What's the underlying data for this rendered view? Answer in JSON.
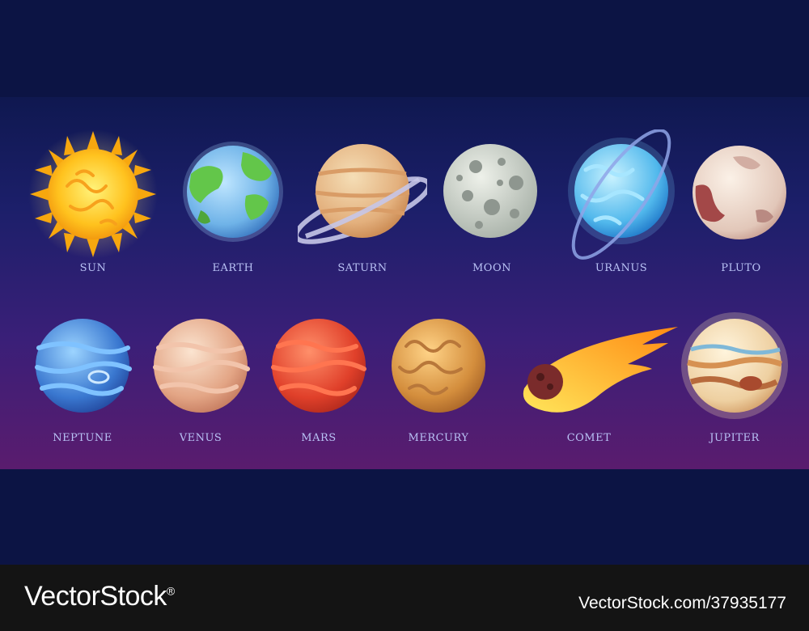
{
  "bodies": [
    {
      "label": "SUN"
    },
    {
      "label": "EARTH"
    },
    {
      "label": "SATURN"
    },
    {
      "label": "MOON"
    },
    {
      "label": "URANUS"
    },
    {
      "label": "PLUTO"
    },
    {
      "label": "NEPTUNE"
    },
    {
      "label": "VENUS"
    },
    {
      "label": "MARS"
    },
    {
      "label": "MERCURY"
    },
    {
      "label": "COMET"
    },
    {
      "label": "JUPITER"
    }
  ],
  "footer": {
    "brand": "VectorStock",
    "registered_mark": "®",
    "stock_id": "VectorStock.com/37935177"
  },
  "colors": {
    "background": "#0c1444",
    "label": "#b9c2f5",
    "footer": "#141414"
  }
}
